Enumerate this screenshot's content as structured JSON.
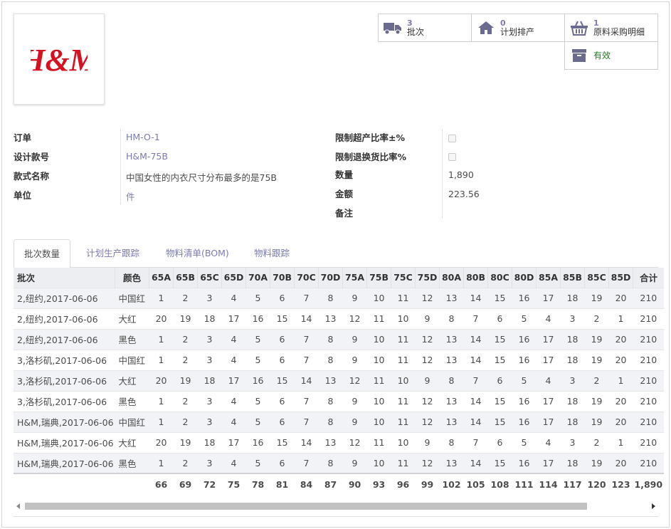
{
  "logo": {
    "text": "H&M",
    "color": "#d51122"
  },
  "buttons": {
    "batches": {
      "count": "3",
      "label": "批次",
      "icon": "truck-icon"
    },
    "plans": {
      "count": "0",
      "label": "计划排产",
      "icon": "home-icon"
    },
    "purchase": {
      "count": "1",
      "label": "原料采购明细",
      "icon": "basket-icon"
    },
    "status": {
      "label": "有效",
      "icon": "archive-box-icon"
    }
  },
  "fields": {
    "order_label": "订单",
    "order_value": "HM-O-1",
    "design_label": "设计款号",
    "design_value": "H&M-75B",
    "style_label": "款式名称",
    "style_value": "中国女性的内衣尺寸分布最多的是75B",
    "unit_label": "单位",
    "unit_value": "件",
    "over_label": "限制超产比率±%",
    "return_label": "限制退换货比率%",
    "qty_label": "数量",
    "qty_value": "1,890",
    "amount_label": "金额",
    "amount_value": "223.56",
    "note_label": "备注"
  },
  "tabs": [
    "批次数量",
    "计划生产跟踪",
    "物料清单(BOM)",
    "物料跟踪"
  ],
  "table": {
    "headers": [
      "批次",
      "颜色",
      "65A",
      "65B",
      "65C",
      "65D",
      "70A",
      "70B",
      "70C",
      "70D",
      "75A",
      "75B",
      "75C",
      "75D",
      "80A",
      "80B",
      "80C",
      "80D",
      "85A",
      "85B",
      "85C",
      "85D",
      "合计"
    ],
    "rows": [
      [
        "2,纽约,2017-06-06",
        "中国红",
        "1",
        "2",
        "3",
        "4",
        "5",
        "6",
        "7",
        "8",
        "9",
        "10",
        "11",
        "12",
        "13",
        "14",
        "15",
        "16",
        "17",
        "18",
        "19",
        "20",
        "210"
      ],
      [
        "2,纽约,2017-06-06",
        "大红",
        "20",
        "19",
        "18",
        "17",
        "16",
        "15",
        "14",
        "13",
        "12",
        "11",
        "10",
        "9",
        "8",
        "7",
        "6",
        "5",
        "4",
        "3",
        "2",
        "1",
        "210"
      ],
      [
        "2,纽约,2017-06-06",
        "黑色",
        "1",
        "2",
        "3",
        "4",
        "5",
        "6",
        "7",
        "8",
        "9",
        "10",
        "11",
        "12",
        "13",
        "14",
        "15",
        "16",
        "17",
        "18",
        "19",
        "20",
        "210"
      ],
      [
        "3,洛杉矶,2017-06-06",
        "中国红",
        "1",
        "2",
        "3",
        "4",
        "5",
        "6",
        "7",
        "8",
        "9",
        "10",
        "11",
        "12",
        "13",
        "14",
        "15",
        "16",
        "17",
        "18",
        "19",
        "20",
        "210"
      ],
      [
        "3,洛杉矶,2017-06-06",
        "大红",
        "20",
        "19",
        "18",
        "17",
        "16",
        "15",
        "14",
        "13",
        "12",
        "11",
        "10",
        "9",
        "8",
        "7",
        "6",
        "5",
        "4",
        "3",
        "2",
        "1",
        "210"
      ],
      [
        "3,洛杉矶,2017-06-06",
        "黑色",
        "1",
        "2",
        "3",
        "4",
        "5",
        "6",
        "7",
        "8",
        "9",
        "10",
        "11",
        "12",
        "13",
        "14",
        "15",
        "16",
        "17",
        "18",
        "19",
        "20",
        "210"
      ],
      [
        "H&M,瑞典,2017-06-06",
        "中国红",
        "1",
        "2",
        "3",
        "4",
        "5",
        "6",
        "7",
        "8",
        "9",
        "10",
        "11",
        "12",
        "13",
        "14",
        "15",
        "16",
        "17",
        "18",
        "19",
        "20",
        "210"
      ],
      [
        "H&M,瑞典,2017-06-06",
        "大红",
        "20",
        "19",
        "18",
        "17",
        "16",
        "15",
        "14",
        "13",
        "12",
        "11",
        "10",
        "9",
        "8",
        "7",
        "6",
        "5",
        "4",
        "3",
        "2",
        "1",
        "210"
      ],
      [
        "H&M,瑞典,2017-06-06",
        "黑色",
        "1",
        "2",
        "3",
        "4",
        "5",
        "6",
        "7",
        "8",
        "9",
        "10",
        "11",
        "12",
        "13",
        "14",
        "15",
        "16",
        "17",
        "18",
        "19",
        "20",
        "210"
      ]
    ],
    "totals": [
      "",
      "",
      "66",
      "69",
      "72",
      "75",
      "78",
      "81",
      "84",
      "87",
      "90",
      "93",
      "96",
      "99",
      "102",
      "105",
      "108",
      "111",
      "114",
      "117",
      "120",
      "123",
      "1,890"
    ]
  },
  "colors": {
    "accent": "#7c7bad",
    "status_green": "#1e7a1e",
    "icon": "#6b6b8f"
  }
}
